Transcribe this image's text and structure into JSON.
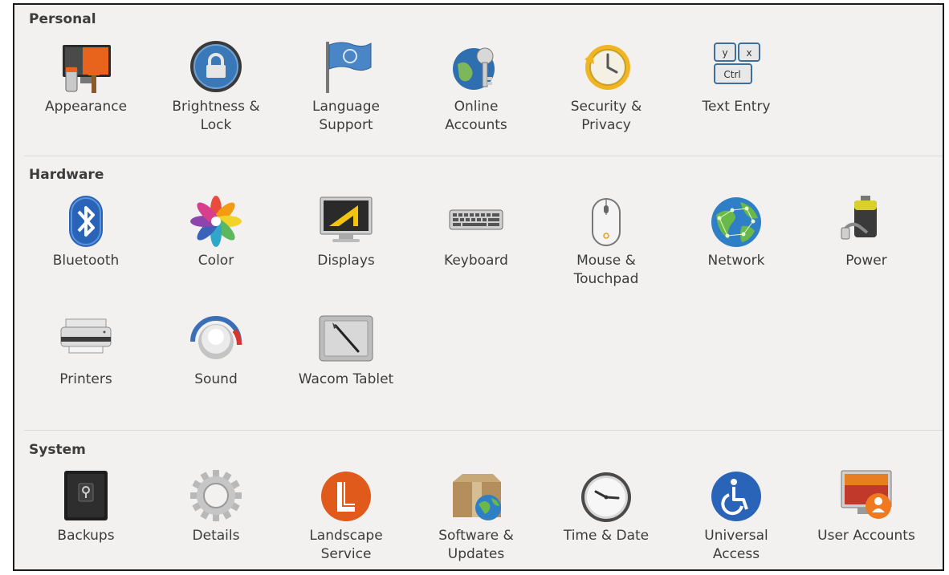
{
  "sections": {
    "personal": {
      "title": "Personal",
      "items": [
        {
          "label": "Appearance",
          "icon": "appearance-icon"
        },
        {
          "label": "Brightness &\nLock",
          "icon": "brightness-lock-icon"
        },
        {
          "label": "Language\nSupport",
          "icon": "language-flag-icon"
        },
        {
          "label": "Online\nAccounts",
          "icon": "online-accounts-icon"
        },
        {
          "label": "Security &\nPrivacy",
          "icon": "security-privacy-icon"
        },
        {
          "label": "Text Entry",
          "icon": "text-entry-keys-icon"
        }
      ]
    },
    "hardware": {
      "title": "Hardware",
      "items": [
        {
          "label": "Bluetooth",
          "icon": "bluetooth-icon"
        },
        {
          "label": "Color",
          "icon": "color-icon"
        },
        {
          "label": "Displays",
          "icon": "displays-icon"
        },
        {
          "label": "Keyboard",
          "icon": "keyboard-icon"
        },
        {
          "label": "Mouse &\nTouchpad",
          "icon": "mouse-icon"
        },
        {
          "label": "Network",
          "icon": "network-globe-icon"
        },
        {
          "label": "Power",
          "icon": "power-battery-icon"
        },
        {
          "label": "Printers",
          "icon": "printer-icon"
        },
        {
          "label": "Sound",
          "icon": "sound-knob-icon"
        },
        {
          "label": "Wacom Tablet",
          "icon": "wacom-tablet-icon"
        }
      ]
    },
    "system": {
      "title": "System",
      "items": [
        {
          "label": "Backups",
          "icon": "backups-safe-icon"
        },
        {
          "label": "Details",
          "icon": "details-gear-icon"
        },
        {
          "label": "Landscape\nService",
          "icon": "landscape-icon"
        },
        {
          "label": "Software &\nUpdates",
          "icon": "software-updates-icon"
        },
        {
          "label": "Time & Date",
          "icon": "clock-icon"
        },
        {
          "label": "Universal\nAccess",
          "icon": "universal-access-icon"
        },
        {
          "label": "User Accounts",
          "icon": "user-accounts-icon"
        }
      ]
    }
  },
  "colors": {
    "background": "#f2f1f0",
    "text": "#3c3c3c",
    "divider": "#dcdad7",
    "bluetooth": "#2a64b8",
    "landscape": "#e05a1c",
    "ubuntu_orange": "#f07920"
  }
}
